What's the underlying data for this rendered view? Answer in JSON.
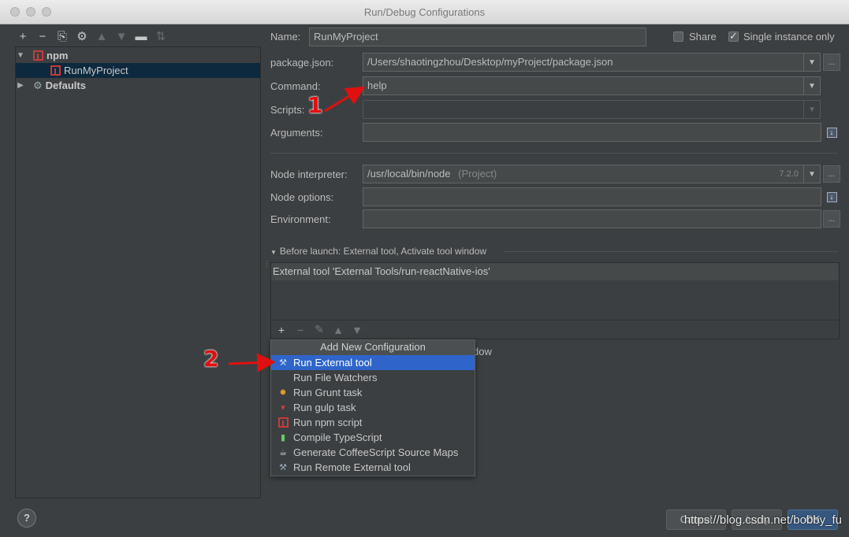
{
  "window": {
    "title": "Run/Debug Configurations"
  },
  "tree": {
    "items": [
      {
        "label": "npm",
        "bold": true
      },
      {
        "label": "RunMyProject",
        "selected": true
      },
      {
        "label": "Defaults",
        "bold": true
      }
    ]
  },
  "form": {
    "name_label": "Name:",
    "name_value": "RunMyProject",
    "share_label": "Share",
    "single_instance_label": "Single instance only",
    "package_json_label": "package.json:",
    "package_json_value": "/Users/shaotingzhou/Desktop/myProject/package.json",
    "command_label": "Command:",
    "command_value": "help",
    "scripts_label": "Scripts:",
    "arguments_label": "Arguments:",
    "node_interpreter_label": "Node interpreter:",
    "node_interpreter_value": "/usr/local/bin/node",
    "node_interpreter_hint": "(Project)",
    "node_version": "7.2.0",
    "node_options_label": "Node options:",
    "environment_label": "Environment:",
    "dots": "..."
  },
  "before_launch": {
    "header": "Before launch: External tool, Activate tool window",
    "items": [
      "External tool 'External Tools/run-reactNative-ios'"
    ],
    "peek_text": "dow"
  },
  "popup": {
    "title": "Add New Configuration",
    "items": [
      {
        "label": "Run External tool",
        "icon": "wrench-icon",
        "selected": true
      },
      {
        "label": "Run File Watchers",
        "icon": ""
      },
      {
        "label": "Run Grunt task",
        "icon": "grunt-icon"
      },
      {
        "label": "Run gulp task",
        "icon": "gulp-icon"
      },
      {
        "label": "Run npm script",
        "icon": "npm-icon"
      },
      {
        "label": "Compile TypeScript",
        "icon": "typescript-icon"
      },
      {
        "label": "Generate CoffeeScript Source Maps",
        "icon": "coffee-icon"
      },
      {
        "label": "Run Remote External tool",
        "icon": "wrench-icon"
      }
    ]
  },
  "annotations": {
    "marker1": "1",
    "marker2": "2"
  },
  "footer": {
    "help": "?",
    "cancel": "Cancel",
    "apply": "Apply",
    "ok": "OK",
    "watermark": "https://blog.csdn.net/bobby_fu"
  },
  "colors": {
    "selection": "#2f65ca",
    "accent_red": "#e01010",
    "background": "#3c3f41"
  }
}
